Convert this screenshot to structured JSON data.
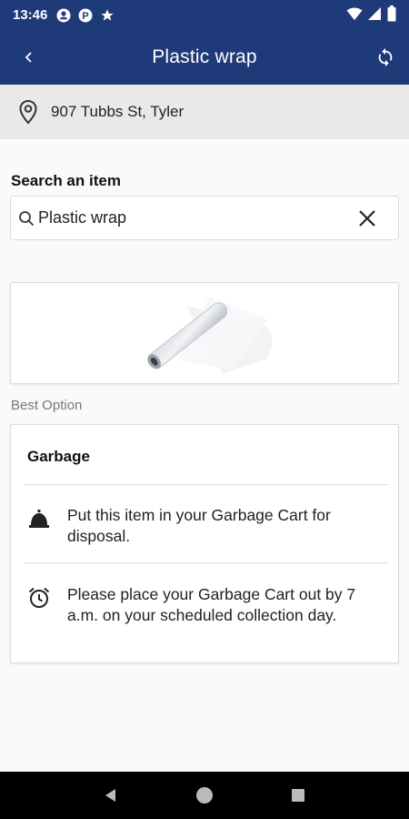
{
  "status_bar": {
    "time": "13:46",
    "icons": [
      "account-circle-icon",
      "parking-p-icon",
      "star-icon",
      "wifi-icon",
      "signal-icon",
      "battery-icon"
    ]
  },
  "app_bar": {
    "title": "Plastic wrap",
    "back_icon": "chevron-left-icon",
    "refresh_icon": "refresh-icon",
    "background": "#1f3a78"
  },
  "address": {
    "text": "907 Tubbs St, Tyler",
    "icon": "location-pin-icon"
  },
  "search": {
    "label": "Search an item",
    "value": "Plastic wrap",
    "icon": "search-icon",
    "clear_icon": "close-icon"
  },
  "item_image": {
    "description_icon": "plastic-wrap-roll-image"
  },
  "best_option_label": "Best Option",
  "result_card": {
    "heading": "Garbage",
    "rows": [
      {
        "icon": "bell-icon",
        "text": "Put this item in your Garbage Cart for disposal."
      },
      {
        "icon": "alarm-clock-icon",
        "text": "Please place your Garbage Cart out by 7 a.m. on your scheduled collection day."
      }
    ]
  },
  "nav_bar": {
    "buttons": [
      "back-triangle-icon",
      "home-circle-icon",
      "recents-square-icon"
    ]
  }
}
